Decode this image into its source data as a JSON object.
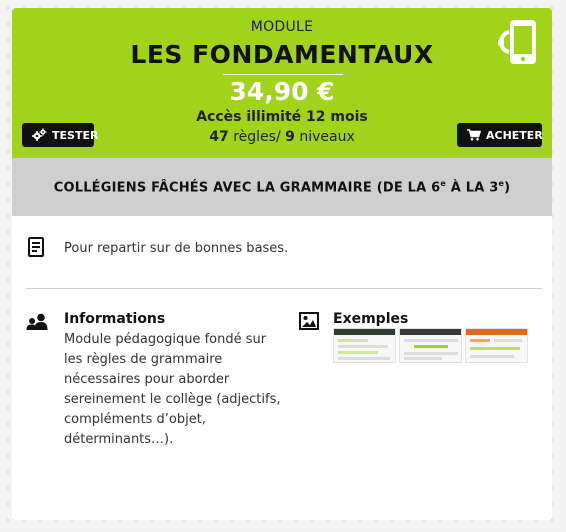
{
  "header": {
    "kicker": "MODULE",
    "title": "LES FONDAMENTAUX",
    "price": "34,90 €",
    "access": "Accès illimité 12 mois",
    "rules_count": "47",
    "rules_label": " règles/ ",
    "levels_count": "9",
    "levels_label": " niveaux",
    "test_button": "TESTER",
    "buy_button": "ACHETER",
    "accent_color": "#a1d31b"
  },
  "banner": {
    "text_before": "COLLÉGIENS FÂCHÉS AVEC LA GRAMMAIRE (DE LA 6",
    "sup1": "e",
    "text_middle": " À LA 3",
    "sup2": "e",
    "text_after": ")"
  },
  "description": {
    "text": "Pour repartir sur de bonnes bases."
  },
  "informations": {
    "title": "Informations",
    "body": "Module pédagogique fondé sur les règles de grammaire nécessaires pour aborder sereinement le collège (adjectifs, compléments d’objet, déterminants…)."
  },
  "examples": {
    "title": "Exemples",
    "thumbnails": [
      "example-screenshot-1",
      "example-screenshot-2",
      "example-screenshot-3"
    ]
  },
  "icons": {
    "phone": "mobile-phone-icon",
    "test": "gears-icon",
    "buy": "cart-icon",
    "description": "document-icon",
    "informations": "users-icon",
    "examples": "image-icon"
  }
}
